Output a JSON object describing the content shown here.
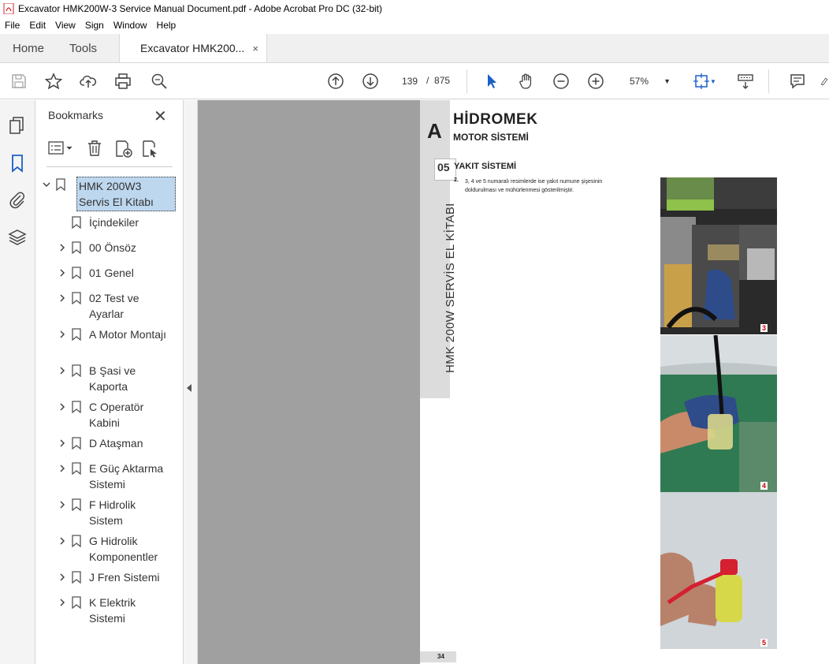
{
  "window": {
    "title": "Excavator HMK200W-3 Service Manual Document.pdf - Adobe Acrobat Pro DC (32-bit)"
  },
  "menu": [
    "File",
    "Edit",
    "View",
    "Sign",
    "Window",
    "Help"
  ],
  "tabs": {
    "home": "Home",
    "tools": "Tools",
    "document": "Excavator HMK200...",
    "close": "×"
  },
  "toolbar": {
    "current_page": "139",
    "page_sep": "/",
    "total_pages": "875",
    "zoom": "57%"
  },
  "bookmarks": {
    "title": "Bookmarks",
    "close": "✕",
    "items": [
      {
        "label": "HMK 200W3 Servis El Kitabı",
        "expanded": true,
        "selected": true
      },
      {
        "label": "İçindekiler",
        "expandable": false
      },
      {
        "label": "00 Önsöz",
        "expandable": true
      },
      {
        "label": "01 Genel",
        "expandable": true
      },
      {
        "label": "02 Test ve Ayarlar",
        "expandable": true
      },
      {
        "label": "A Motor Montajı",
        "expandable": true
      },
      {
        "label": "B Şasi ve Kaporta",
        "expandable": true
      },
      {
        "label": "C Operatör Kabini",
        "expandable": true
      },
      {
        "label": "D Ataşman",
        "expandable": true
      },
      {
        "label": "E Güç Aktarma Sistemi",
        "expandable": true
      },
      {
        "label": "F Hidrolik Sistem",
        "expandable": true
      },
      {
        "label": "G Hidrolik Komponentler",
        "expandable": true
      },
      {
        "label": "J Fren Sistemi",
        "expandable": true
      },
      {
        "label": "K Elektrik Sistemi",
        "expandable": true
      }
    ]
  },
  "page": {
    "letter": "A",
    "chapter_num": "05",
    "vertical_title": "HMK 200W SERVİS EL KİTABI",
    "logo": "HİDROMEK",
    "section": "MOTOR SİSTEMİ",
    "subsection": "YAKIT SİSTEMİ",
    "item_num": "2.",
    "body_line1": "3, 4 ve 5 numaralı resimlerde ise yakıt numune şişesinin",
    "body_line2": "doldurulması ve mühürlenmesi gösterilmiştir.",
    "photo_labels": [
      "3",
      "4",
      "5"
    ],
    "page_number": "34"
  },
  "colors": {
    "acrobat_red": "#d4282c",
    "selection": "#bdd7ee",
    "canvas_gray": "#a0a0a0"
  }
}
